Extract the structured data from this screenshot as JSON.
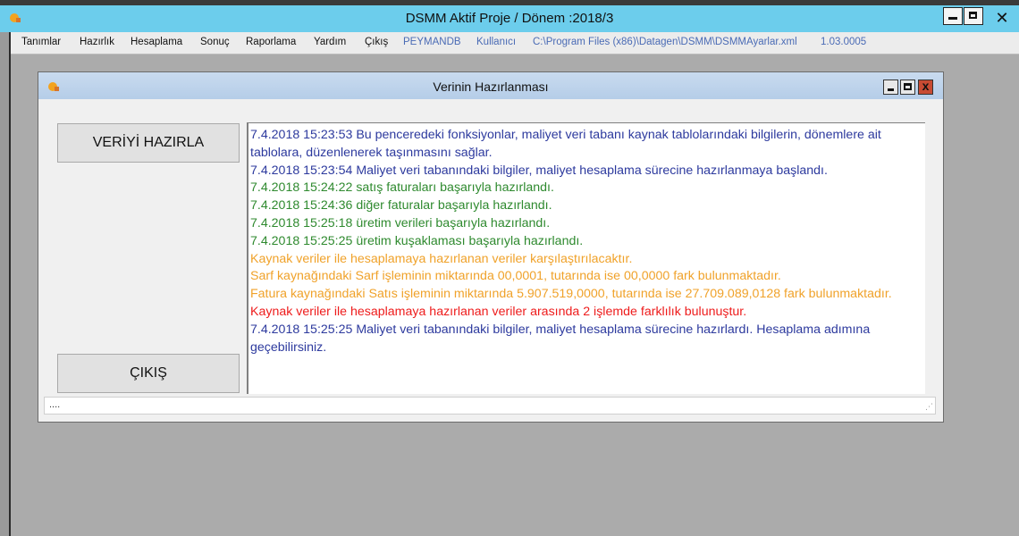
{
  "app": {
    "title": "DSMM Aktif Proje / Dönem :2018/3",
    "close_glyph": "✕",
    "icon": "app-logo-icon"
  },
  "menu": {
    "items": [
      "Tanımlar",
      "Hazırlık",
      "Hesaplama",
      "Sonuç",
      "Raporlama",
      "Yardım",
      "Çıkış"
    ],
    "info": [
      "PEYMANDB",
      "Kullanıcı",
      "C:\\Program Files (x86)\\Datagen\\DSMM\\DSMMAyarlar.xml",
      "1.03.0005"
    ]
  },
  "dialog": {
    "title": "Verinin Hazırlanması",
    "prepare_button": "VERİYİ HAZIRLA",
    "exit_button": "ÇIKIŞ",
    "close_glyph": "x",
    "status_text": "....",
    "grip": "⋰"
  },
  "log": [
    {
      "color": "blue",
      "text": "7.4.2018 15:23:53 Bu penceredeki fonksiyonlar, maliyet veri tabanı kaynak tablolarındaki bilgilerin, dönemlere ait tablolara, düzenlenerek taşınmasını sağlar."
    },
    {
      "color": "blue",
      "text": "7.4.2018 15:23:54 Maliyet veri tabanındaki bilgiler, maliyet hesaplama sürecine hazırlanmaya başlandı."
    },
    {
      "color": "green",
      "text": "7.4.2018 15:24:22 satış faturaları başarıyla hazırlandı."
    },
    {
      "color": "green",
      "text": "7.4.2018 15:24:36 diğer faturalar başarıyla hazırlandı."
    },
    {
      "color": "green",
      "text": "7.4.2018 15:25:18 üretim verileri başarıyla hazırlandı."
    },
    {
      "color": "green",
      "text": "7.4.2018 15:25:25 üretim kuşaklaması başarıyla hazırlandı."
    },
    {
      "color": "orange",
      "text": "Kaynak veriler ile hesaplamaya hazırlanan veriler karşılaştırılacaktır."
    },
    {
      "color": "orange",
      "text": "Sarf kaynağındaki Sarf işleminin miktarında 00,0001, tutarında ise 00,0000 fark bulunmaktadır."
    },
    {
      "color": "orange",
      "text": "Fatura kaynağındaki Satıs işleminin miktarında 5.907.519,0000, tutarında ise 27.709.089,0128 fark bulunmaktadır."
    },
    {
      "color": "red",
      "text": "Kaynak veriler ile hesaplamaya hazırlanan veriler arasında 2 işlemde farklılık bulunuştur."
    },
    {
      "color": "blue",
      "text": "7.4.2018 15:25:25 Maliyet veri tabanındaki bilgiler, maliyet hesaplama sürecine hazırlardı. Hesaplama adımına geçebilirsiniz."
    }
  ]
}
